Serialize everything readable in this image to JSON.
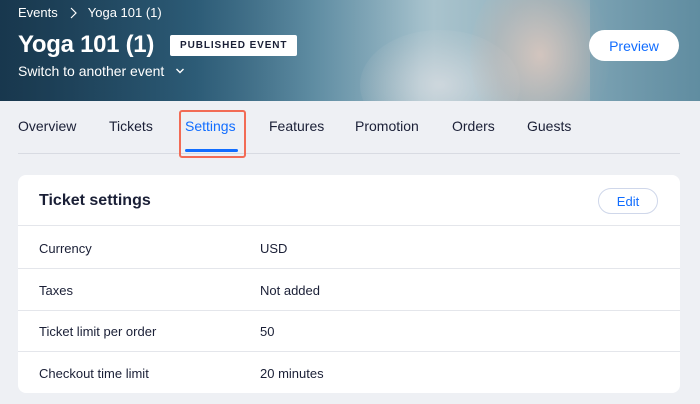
{
  "breadcrumb": {
    "parent": "Events",
    "current": "Yoga 101 (1)"
  },
  "event": {
    "title": "Yoga 101 (1)",
    "status_badge": "PUBLISHED EVENT",
    "switch_label": "Switch to another event"
  },
  "header": {
    "preview_label": "Preview"
  },
  "tabs": [
    {
      "label": "Overview"
    },
    {
      "label": "Tickets"
    },
    {
      "label": "Settings",
      "active": true
    },
    {
      "label": "Features"
    },
    {
      "label": "Promotion"
    },
    {
      "label": "Orders"
    },
    {
      "label": "Guests"
    }
  ],
  "ticket_settings": {
    "title": "Ticket settings",
    "edit_label": "Edit",
    "rows": [
      {
        "label": "Currency",
        "value": "USD"
      },
      {
        "label": "Taxes",
        "value": "Not added"
      },
      {
        "label": "Ticket limit per order",
        "value": "50"
      },
      {
        "label": "Checkout time limit",
        "value": "20 minutes"
      }
    ]
  },
  "colors": {
    "accent": "#116dff",
    "highlight": "#f26b55",
    "background": "#eef0f4"
  },
  "icons": {
    "breadcrumb_separator": "chevron-right-icon",
    "switch_event": "chevron-down-icon"
  }
}
